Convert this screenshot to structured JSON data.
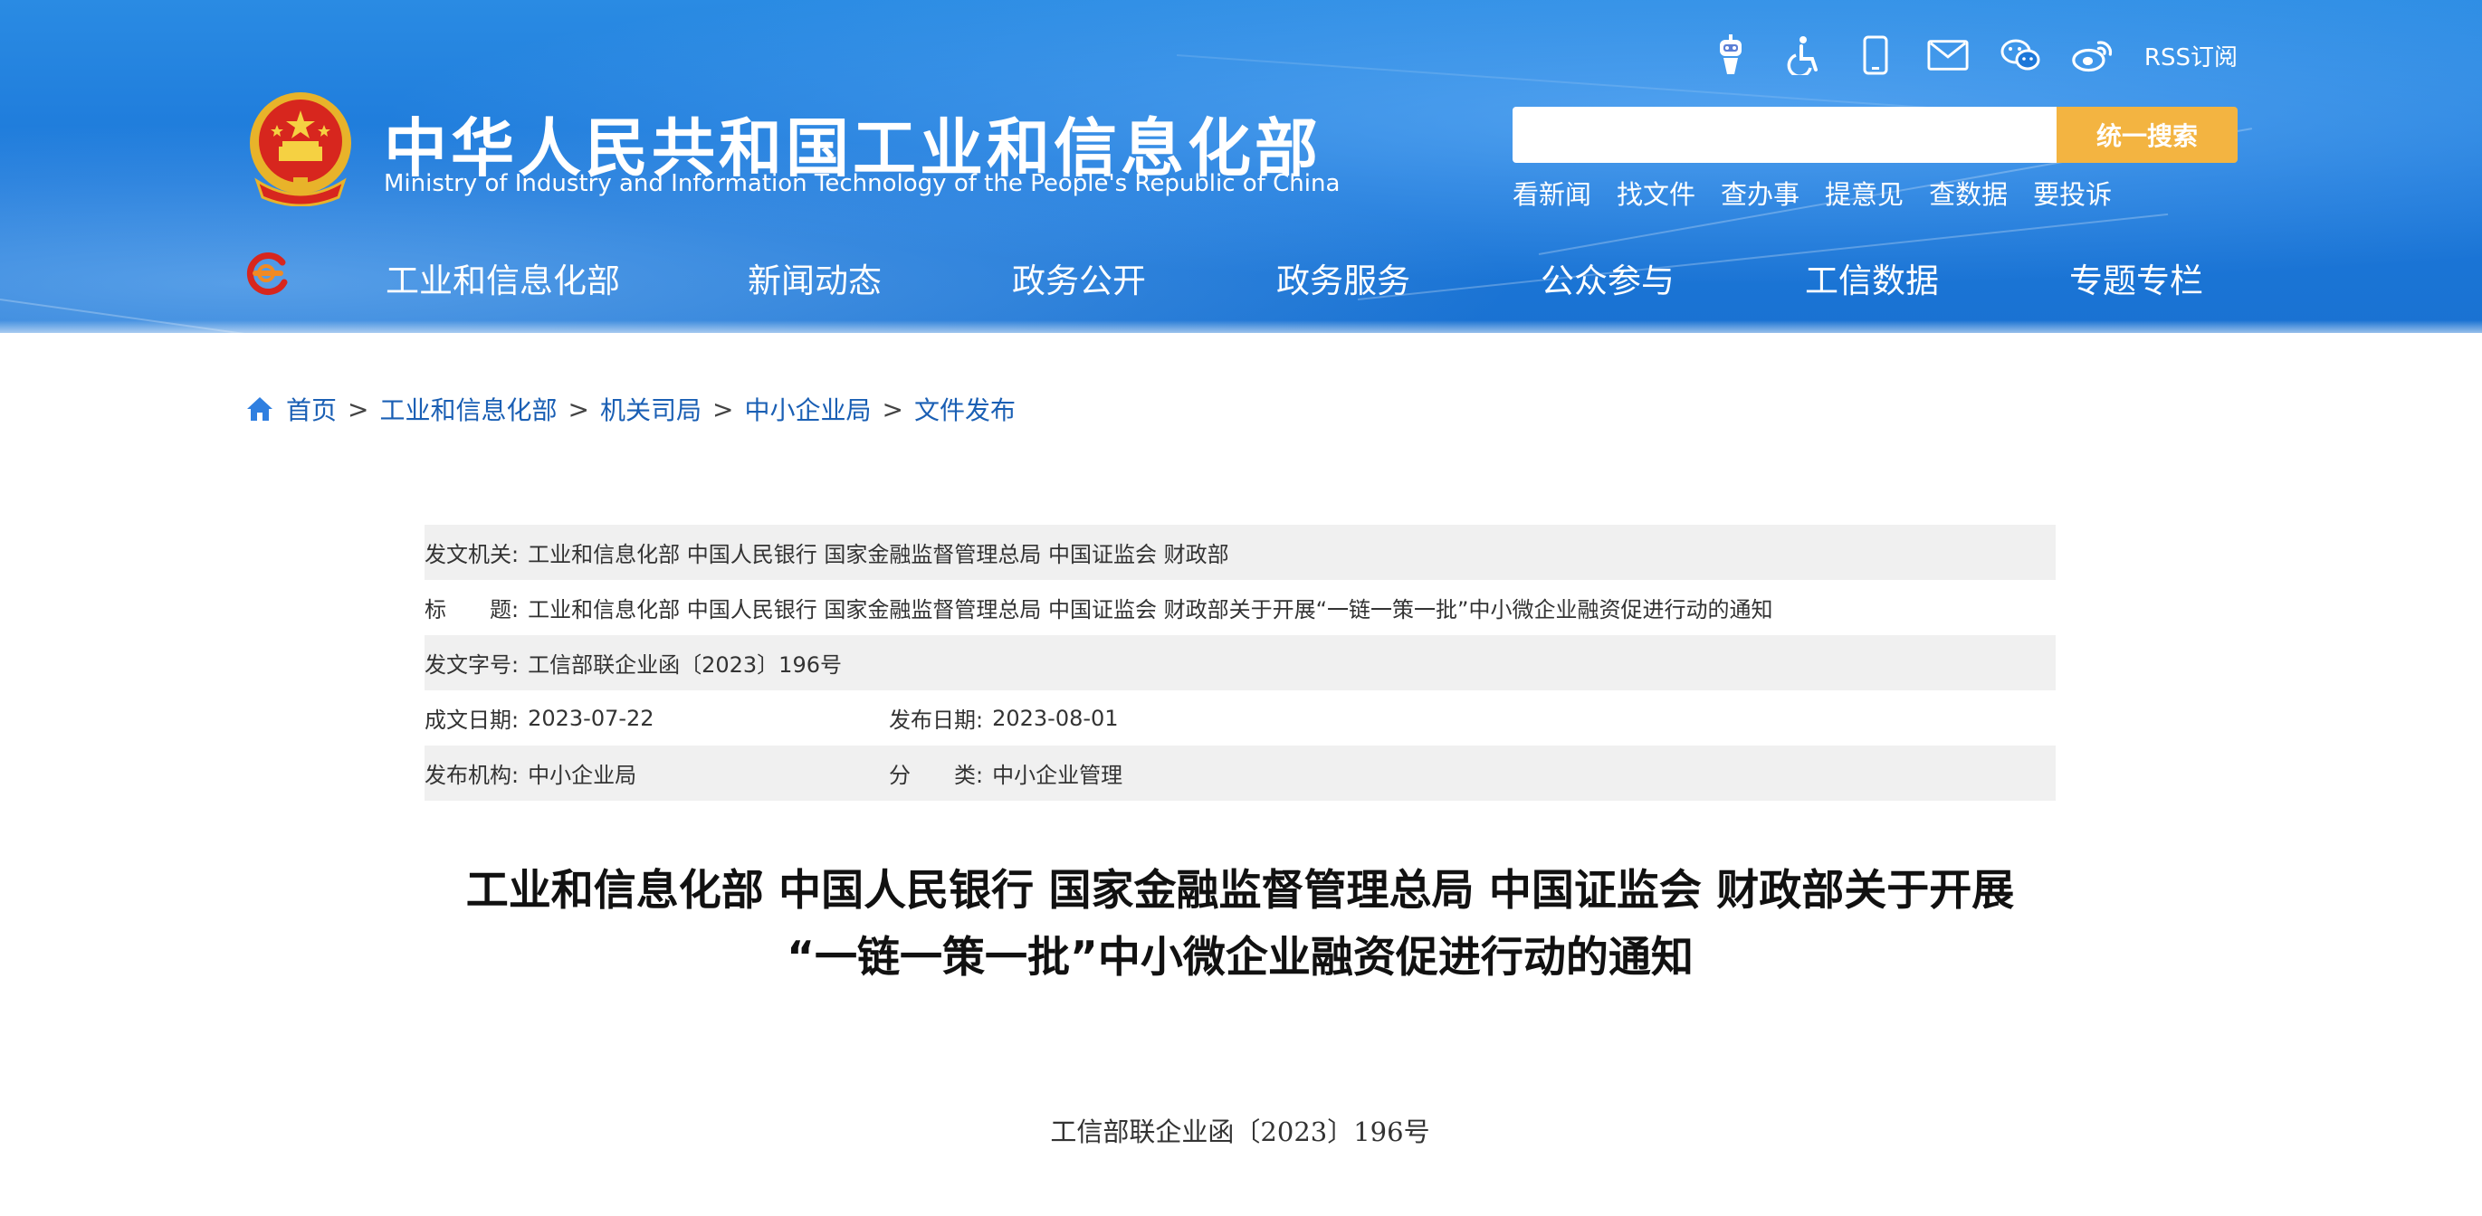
{
  "header": {
    "title_cn": "中华人民共和国工业和信息化部",
    "title_en": "Ministry of Industry and Information Technology of the People's Republic of China",
    "icons": [
      "robot-icon",
      "accessibility-icon",
      "mobile-icon",
      "mail-icon",
      "wechat-icon",
      "weibo-icon"
    ],
    "rss_label": "RSS订阅",
    "search": {
      "placeholder": "",
      "button_label": "统一搜索"
    },
    "quick_links": [
      "看新闻",
      "找文件",
      "查办事",
      "提意见",
      "查数据",
      "要投诉"
    ]
  },
  "nav": {
    "items": [
      "工业和信息化部",
      "新闻动态",
      "政务公开",
      "政务服务",
      "公众参与",
      "工信数据",
      "专题专栏"
    ]
  },
  "breadcrumb": [
    "首页",
    "工业和信息化部",
    "机关司局",
    "中小企业局",
    "文件发布"
  ],
  "info": {
    "issuer_label": "发文机关:",
    "issuer": "工业和信息化部 中国人民银行 国家金融监督管理总局 中国证监会 财政部",
    "title_label": "标　　题:",
    "title": "工业和信息化部 中国人民银行 国家金融监督管理总局 中国证监会 财政部关于开展“一链一策一批”中小微企业融资促进行动的通知",
    "doc_no_label": "发文字号:",
    "doc_no": "工信部联企业函〔2023〕196号",
    "created_label": "成文日期:",
    "created": "2023-07-22",
    "published_label": "发布日期:",
    "published": "2023-08-01",
    "agency_label": "发布机构:",
    "agency": "中小企业局",
    "category_label": "分　　类:",
    "category": "中小企业管理"
  },
  "document": {
    "title_line1": "工业和信息化部 中国人民银行 国家金融监督管理总局 中国证监会 财政部关于开展",
    "title_line2": "“一链一策一批”中小微企业融资促进行动的通知",
    "number": "工信部联企业函〔2023〕196号"
  },
  "colors": {
    "header_blue": "#1b77d9",
    "search_button": "#f3b441",
    "link_blue": "#1a5fb4",
    "row_shade": "#f0f0f0"
  }
}
